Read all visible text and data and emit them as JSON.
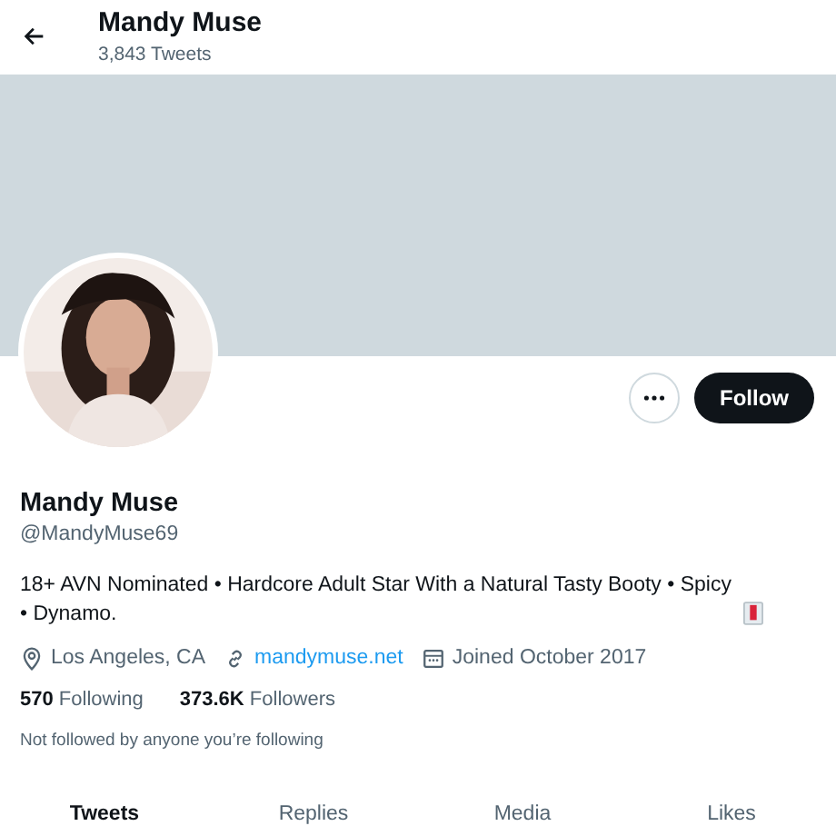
{
  "header": {
    "name": "Mandy Muse",
    "count": "3,843 Tweets"
  },
  "profile": {
    "name": "Mandy Muse",
    "handle": "@MandyMuse69",
    "bio": "18+ AVN Nominated • Hardcore Adult Star With a Natural Tasty Booty • Spicy • Dynamo.",
    "location": "Los Angeles, CA",
    "website": "mandymuse.net",
    "joined": "Joined October 2017",
    "following_count": "570",
    "following_label": "Following",
    "followers_count": "373.6K",
    "followers_label": "Followers",
    "followed_by": "Not followed by anyone you’re following"
  },
  "follow_button": "Follow",
  "tabs": [
    {
      "label": "Tweets",
      "selected": true
    },
    {
      "label": "Replies",
      "selected": false
    },
    {
      "label": "Media",
      "selected": false
    },
    {
      "label": "Likes",
      "selected": false
    }
  ]
}
